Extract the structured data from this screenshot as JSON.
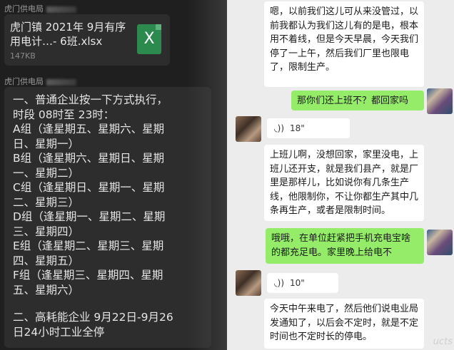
{
  "left_pane": {
    "sender_1": "虎门供电局",
    "file": {
      "title": "虎门镇 2021年 9月有序用电计…- 6班.xlsx",
      "size": "147KB",
      "icon_letter": "X",
      "icon": "excel-file-icon"
    },
    "sender_2": "虎门供电局",
    "notice_lines": [
      "一、普通企业按一下方式执行，",
      "时段 08时至 23时：",
      "A组（逢星期五、星期六、星期",
      "日、星期一）",
      "B组（逢星期六、星期日、星期",
      "一、星期二）",
      "C组（逢星期日、星期一、星期",
      "二、星期三）",
      "D组（逢星期一、星期二、星期",
      "三、星期四）",
      "E组（逢星期二、星期三、星期",
      "四、星期五）",
      "F组（逢星期三、星期四、星期",
      "五、星期六）",
      "",
      "二、高耗能企业 9月22日-9月26",
      "日24小时工业全停"
    ]
  },
  "right_pane": {
    "messages": [
      {
        "from": "other",
        "type": "text",
        "text": "嗯，以前我们这儿可从来没管过，以前我都认为我们这儿有的是电，根本用不着线，但是今天早晨，今天我们停了一上午，然后我们厂里也限电了，限制生产。"
      },
      {
        "from": "me",
        "type": "text",
        "text": "那你们还上班不？都回家吗"
      },
      {
        "from": "other",
        "type": "voice",
        "duration": "18\""
      },
      {
        "from": "other",
        "type": "text",
        "text": "上班儿啊，没想回家，家里没电，上班儿还开支，就是我们县产，就是厂里是那样儿，比如说你有几条生产线，他限制你，不让你都生产其中几条再生产，或者是限制时间。"
      },
      {
        "from": "me",
        "type": "text",
        "text": "哦哦，在单位赶紧把手机充电宝啥的都充足电。家里晚上给电不"
      },
      {
        "from": "other",
        "type": "voice",
        "duration": "10\""
      },
      {
        "from": "other",
        "type": "text",
        "text": "今天中午来电了，然后他们说电业局发通知了，以后会不定时，就是不定时间也不定时长的停电。"
      }
    ],
    "voice_icon": "voice-wave-icon",
    "watermark": "ucts"
  },
  "colors": {
    "dark_bg": "#1f1f1f",
    "dark_bubble": "#2d2d2d",
    "chat_bg": "#ececec",
    "my_bubble": "#95ec69",
    "their_bubble": "#ffffff",
    "excel_green": "#2d8a4e"
  }
}
